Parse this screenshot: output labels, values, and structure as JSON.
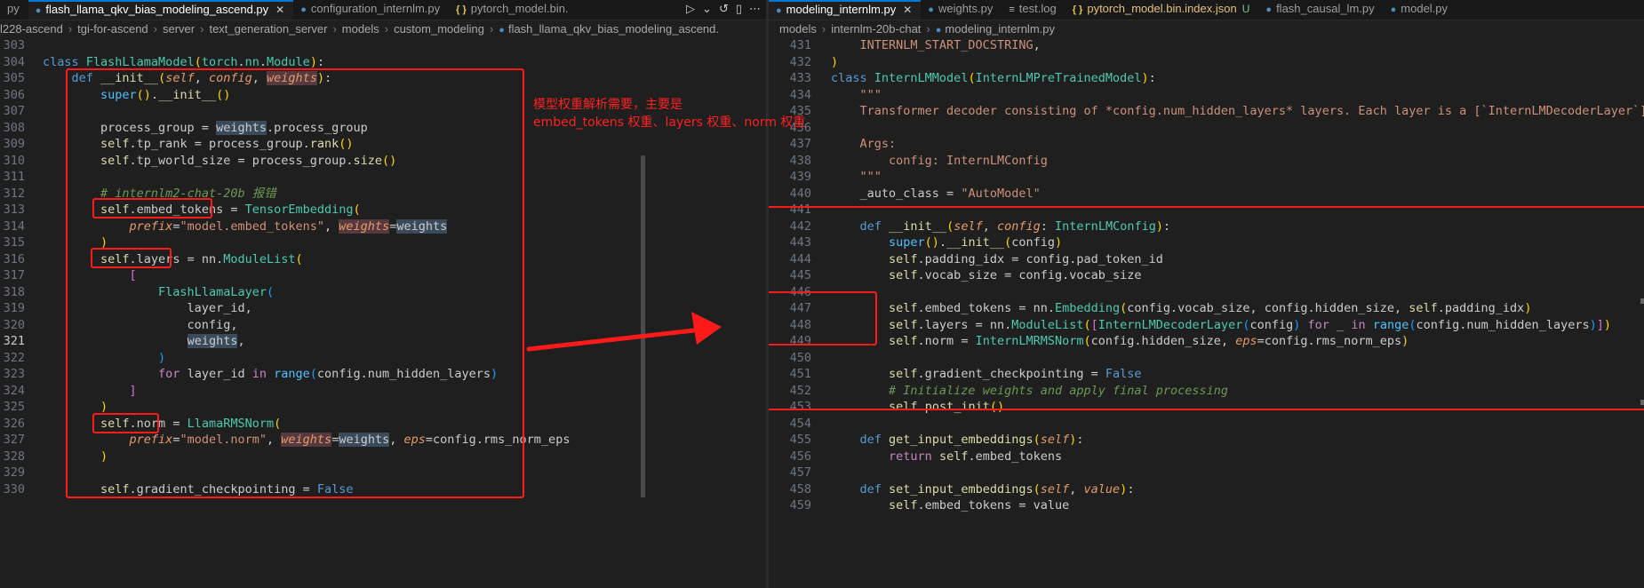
{
  "left_pane": {
    "tabs": [
      {
        "label": "py",
        "icon": "none"
      },
      {
        "label": "flash_llama_qkv_bias_modeling_ascend.py",
        "icon": "python-icon",
        "active": true
      },
      {
        "label": "configuration_internlm.py",
        "icon": "python-icon"
      },
      {
        "label": "pytorch_model.bin.",
        "icon": "json-icon"
      }
    ],
    "actions": [
      "▷",
      "⌄",
      "↺",
      "▯",
      "⋯"
    ],
    "breadcrumbs": [
      "l228-ascend",
      "tgi-for-ascend",
      "server",
      "text_generation_server",
      "models",
      "custom_modeling",
      "flash_llama_qkv_bias_modeling_ascend."
    ],
    "lines": [
      {
        "n": "303",
        "h": ""
      },
      {
        "n": "304",
        "h": "<span class=\"kw2\">class</span> <span class=\"cls\">FlashLlamaModel</span><span class=\"ybr\">(</span><span class=\"cls\">torch</span>.<span class=\"cls\">nn</span>.<span class=\"cls\">Module</span><span class=\"ybr\">)</span>:"
      },
      {
        "n": "305",
        "h": "    <span class=\"kw2\">def</span> <span class=\"fn\">__init__</span><span class=\"ybr\">(</span><span class=\"prm\">self</span>, <span class=\"prm\">config</span>, <span class=\"prm hlw\">weights</span><span class=\"ybr\">)</span>:"
      },
      {
        "n": "306",
        "h": "        <span class=\"bi\">super</span><span class=\"ybr\">()</span>.<span class=\"fn\">__init__</span><span class=\"ybr\">()</span>"
      },
      {
        "n": "307",
        "h": ""
      },
      {
        "n": "308",
        "h": "        process_group = <span class=\"hl\">weights</span>.process_group"
      },
      {
        "n": "309",
        "h": "        <span class=\"self\">self</span>.tp_rank = process_group.<span class=\"fn\">rank</span><span class=\"ybr\">()</span>"
      },
      {
        "n": "310",
        "h": "        <span class=\"self\">self</span>.tp_world_size = process_group.<span class=\"fn\">size</span><span class=\"ybr\">()</span>"
      },
      {
        "n": "311",
        "h": ""
      },
      {
        "n": "312",
        "h": "        <span class=\"cm\"># internlm2-chat-20b 报错</span>"
      },
      {
        "n": "313",
        "h": "        <span class=\"self\">self</span>.embed_tokens = <span class=\"cls\">TensorEmbedding</span><span class=\"ybr\">(</span>"
      },
      {
        "n": "314",
        "h": "            <span class=\"prm\">prefix</span>=<span class=\"str\">\"model.embed_tokens\"</span>, <span class=\"prm hlw\">weights</span>=<span class=\"hl\">weights</span>"
      },
      {
        "n": "315",
        "h": "        <span class=\"ybr\">)</span>"
      },
      {
        "n": "316",
        "h": "        <span class=\"self\">self</span>.layers = nn.<span class=\"cls\">ModuleList</span><span class=\"ybr\">(</span>"
      },
      {
        "n": "317",
        "h": "            <span class=\"pbr\">[</span>"
      },
      {
        "n": "318",
        "h": "                <span class=\"cls\">FlashLlamaLayer</span><span class=\"bbr\">(</span>"
      },
      {
        "n": "319",
        "h": "                    layer_id,"
      },
      {
        "n": "320",
        "h": "                    config,"
      },
      {
        "n": "321",
        "h": "                    <span class=\"hl\">weights</span>,",
        "cur": true
      },
      {
        "n": "322",
        "h": "                <span class=\"bbr\">)</span>"
      },
      {
        "n": "323",
        "h": "                <span class=\"kw\">for</span> layer_id <span class=\"kw\">in</span> <span class=\"bi\">range</span><span class=\"bbr\">(</span>config.num_hidden_layers<span class=\"bbr\">)</span>"
      },
      {
        "n": "324",
        "h": "            <span class=\"pbr\">]</span>"
      },
      {
        "n": "325",
        "h": "        <span class=\"ybr\">)</span>"
      },
      {
        "n": "326",
        "h": "        <span class=\"self\">self</span>.norm = <span class=\"cls\">LlamaRMSNorm</span><span class=\"ybr\">(</span>"
      },
      {
        "n": "327",
        "h": "            <span class=\"prm\">prefix</span>=<span class=\"str\">\"model.norm\"</span>, <span class=\"prm hlw\">weights</span>=<span class=\"hl\">weights</span>, <span class=\"prm\">eps</span>=config.rms_norm_eps"
      },
      {
        "n": "328",
        "h": "        <span class=\"ybr\">)</span>"
      },
      {
        "n": "329",
        "h": ""
      },
      {
        "n": "330",
        "h": "        <span class=\"self\">self</span>.gradient_checkpointing = <span class=\"kw2\">False</span>"
      }
    ]
  },
  "right_pane": {
    "tabs": [
      {
        "label": "modeling_internlm.py",
        "icon": "python-icon",
        "active": true
      },
      {
        "label": "weights.py",
        "icon": "python-icon"
      },
      {
        "label": "test.log",
        "icon": "log-icon"
      },
      {
        "label": "pytorch_model.bin.index.json",
        "icon": "json-icon",
        "badge": "U"
      },
      {
        "label": "flash_causal_lm.py",
        "icon": "python-icon"
      },
      {
        "label": "model.py",
        "icon": "python-icon"
      }
    ],
    "breadcrumbs": [
      "models",
      "internlm-20b-chat",
      "modeling_internlm.py"
    ],
    "lines": [
      {
        "n": "431",
        "h": "    <span class=\"str\">INTERNLM_START_DOCSTRING</span>,"
      },
      {
        "n": "432",
        "h": "<span class=\"ybr\">)</span>"
      },
      {
        "n": "433",
        "h": "<span class=\"kw2\">class</span> <span class=\"cls\">InternLMModel</span><span class=\"ybr\">(</span><span class=\"cls\">InternLMPreTrainedModel</span><span class=\"ybr\">)</span>:"
      },
      {
        "n": "434",
        "h": "    <span class=\"str\">\"\"\"</span>"
      },
      {
        "n": "435",
        "h": "    <span class=\"str\">Transformer decoder consisting of *config.num_hidden_layers* layers. Each layer is a [`InternLMDecoderLayer`]</span>"
      },
      {
        "n": "436",
        "h": ""
      },
      {
        "n": "437",
        "h": "    <span class=\"str\">Args:</span>"
      },
      {
        "n": "438",
        "h": "        <span class=\"str\">config: InternLMConfig</span>"
      },
      {
        "n": "439",
        "h": "    <span class=\"str\">\"\"\"</span>"
      },
      {
        "n": "440",
        "h": "    _auto_class = <span class=\"str\">\"AutoModel\"</span>"
      },
      {
        "n": "441",
        "h": ""
      },
      {
        "n": "442",
        "h": "    <span class=\"kw2\">def</span> <span class=\"fn\">__init__</span><span class=\"ybr\">(</span><span class=\"prm\">self</span>, <span class=\"prm\">config</span>: <span class=\"cls\">InternLMConfig</span><span class=\"ybr\">)</span>:"
      },
      {
        "n": "443",
        "h": "        <span class=\"bi\">super</span><span class=\"ybr\">()</span>.<span class=\"fn\">__init__</span><span class=\"ybr\">(</span>config<span class=\"ybr\">)</span>"
      },
      {
        "n": "444",
        "h": "        <span class=\"self\">self</span>.padding_idx = config.pad_token_id"
      },
      {
        "n": "445",
        "h": "        <span class=\"self\">self</span>.vocab_size = config.vocab_size"
      },
      {
        "n": "446",
        "h": ""
      },
      {
        "n": "447",
        "h": "        <span class=\"self\">self</span>.embed_tokens = nn.<span class=\"cls\">Embedding</span><span class=\"ybr\">(</span>config.vocab_size, config.hidden_size, <span class=\"self\">self</span>.padding_idx<span class=\"ybr\">)</span>"
      },
      {
        "n": "448",
        "h": "        <span class=\"self\">self</span>.layers = nn.<span class=\"cls\">ModuleList</span><span class=\"ybr\">(</span><span class=\"pbr\">[</span><span class=\"cls\">InternLMDecoderLayer</span><span class=\"bbr\">(</span>config<span class=\"bbr\">)</span> <span class=\"kw\">for</span> _ <span class=\"kw\">in</span> <span class=\"bi\">range</span><span class=\"bbr\">(</span>config.num_hidden_layers<span class=\"bbr\">)</span><span class=\"pbr\">]</span><span class=\"ybr\">)</span>"
      },
      {
        "n": "449",
        "h": "        <span class=\"self\">self</span>.norm = <span class=\"cls\">InternLMRMSNorm</span><span class=\"ybr\">(</span>config.hidden_size, <span class=\"prm\">eps</span>=config.rms_norm_eps<span class=\"ybr\">)</span>"
      },
      {
        "n": "450",
        "h": ""
      },
      {
        "n": "451",
        "h": "        <span class=\"self\">self</span>.gradient_checkpointing = <span class=\"kw2\">False</span>"
      },
      {
        "n": "452",
        "h": "        <span class=\"cm\"># Initialize weights and apply final processing</span>"
      },
      {
        "n": "453",
        "h": "        <span class=\"self\">self</span>.<span class=\"fn\">post_init</span><span class=\"ybr\">()</span>"
      },
      {
        "n": "454",
        "h": ""
      },
      {
        "n": "455",
        "h": "    <span class=\"kw2\">def</span> <span class=\"fn\">get_input_embeddings</span><span class=\"ybr\">(</span><span class=\"prm\">self</span><span class=\"ybr\">)</span>:"
      },
      {
        "n": "456",
        "h": "        <span class=\"kw\">return</span> <span class=\"self\">self</span>.embed_tokens"
      },
      {
        "n": "457",
        "h": ""
      },
      {
        "n": "458",
        "h": "    <span class=\"kw2\">def</span> <span class=\"fn\">set_input_embeddings</span><span class=\"ybr\">(</span><span class=\"prm\">self</span>, <span class=\"prm\">value</span><span class=\"ybr\">)</span>:"
      },
      {
        "n": "459",
        "h": "        <span class=\"self\">self</span>.embed_tokens = value"
      }
    ]
  },
  "annotation": {
    "line1": "模型权重解析需要，主要是",
    "line2": "embed_tokens 权重、layers 权重、norm 权重",
    "color": "#ff2020"
  }
}
